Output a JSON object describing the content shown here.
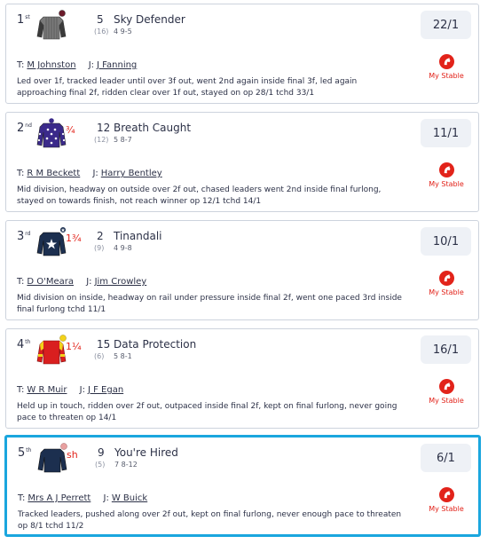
{
  "results": [
    {
      "position": "1",
      "position_suffix": "st",
      "distance": "",
      "number": "5",
      "draw": "(16)",
      "horse": "Sky Defender",
      "figures": "4  9-5",
      "odds": "22/1",
      "trainer_label": "T:",
      "trainer": "M Johnston",
      "jockey_label": "J:",
      "jockey": "J Fanning",
      "comment": "Led over 1f, tracked leader until over 3f out, went 2nd again inside final 3f, led again approaching final 2f, ridden clear over 1f out, stayed on op 28/1 tchd 33/1",
      "stable_label": "My Stable",
      "silk": {
        "body": "#7a7a7a",
        "pattern": "#5a5a5a",
        "sleeves": "#3a3a3a",
        "cap": "#6b1a2a",
        "stars": false
      }
    },
    {
      "position": "2",
      "position_suffix": "nd",
      "distance": "¾",
      "number": "12",
      "draw": "(12)",
      "horse": "Breath Caught",
      "figures": "5  8-7",
      "odds": "11/1",
      "trainer_label": "T:",
      "trainer": "R M Beckett",
      "jockey_label": "J:",
      "jockey": "Harry Bentley",
      "comment": "Mid division, headway on outside over 2f out, chased leaders went 2nd inside final furlong, stayed on towards finish, not reach winner op 12/1 tchd 14/1",
      "stable_label": "My Stable",
      "silk": {
        "body": "#3b2a8a",
        "pattern": "#ffffff",
        "sleeves": "#3b2a8a",
        "cap": "#3b2a8a",
        "stars": true
      }
    },
    {
      "position": "3",
      "position_suffix": "rd",
      "distance": "1¾",
      "number": "2",
      "draw": "(9)",
      "horse": "Tinandali",
      "figures": "4  9-8",
      "odds": "10/1",
      "trainer_label": "T:",
      "trainer": "D O'Meara",
      "jockey_label": "J:",
      "jockey": "Jim Crowley",
      "comment": "Mid division on inside, headway on rail under pressure inside final 2f, went one paced 3rd inside final furlong tchd 11/1",
      "stable_label": "My Stable",
      "silk": {
        "body": "#1c2f4f",
        "pattern": "#ffffff",
        "sleeves": "#1c2f4f",
        "cap": "#1c2f4f",
        "stars": false
      }
    },
    {
      "position": "4",
      "position_suffix": "th",
      "distance": "1¼",
      "number": "15",
      "draw": "(6)",
      "horse": "Data Protection",
      "figures": "5  8-1",
      "odds": "16/1",
      "trainer_label": "T:",
      "trainer": "W R Muir",
      "jockey_label": "J:",
      "jockey": "J F Egan",
      "comment": "Held up in touch, ridden over 2f out, outpaced inside final 2f, kept on final furlong, never going pace to threaten op 14/1",
      "stable_label": "My Stable",
      "silk": {
        "body": "#d91f1f",
        "pattern": "#f2d21a",
        "sleeves": "#d91f1f",
        "cap": "#f2d21a",
        "stars": false
      }
    },
    {
      "position": "5",
      "position_suffix": "th",
      "distance": "sh",
      "number": "9",
      "draw": "(5)",
      "horse": "You're Hired",
      "figures": "7  8-12",
      "odds": "6/1",
      "trainer_label": "T:",
      "trainer": "Mrs A J Perrett",
      "jockey_label": "J:",
      "jockey": "W Buick",
      "comment": "Tracked leaders, pushed along over 2f out, kept on final furlong, never enough pace to threaten op 8/1 tchd 11/2",
      "stable_label": "My Stable",
      "silk": {
        "body": "#1c2f4f",
        "pattern": "#1c2f4f",
        "sleeves": "#1c2f4f",
        "cap": "#e8a0a0",
        "stars": false
      }
    }
  ]
}
